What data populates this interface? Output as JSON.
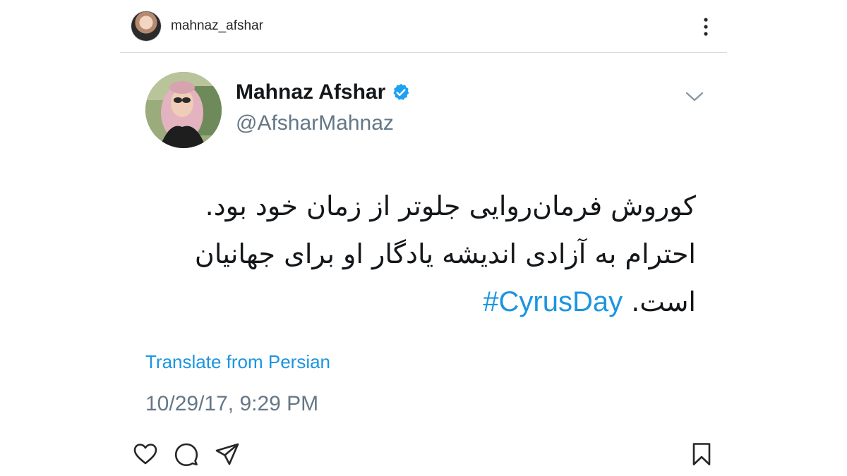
{
  "post": {
    "username": "mahnaz_afshar",
    "avatar_icon": "profile-photo",
    "more_icon": "more-options-icon"
  },
  "tweet": {
    "display_name": "Mahnaz Afshar",
    "handle": "@AfsharMahnaz",
    "verified": true,
    "verified_color": "#1da1f2",
    "text_lines": [
      "کوروش فرمان‌روایی جلوتر از زمان خود بود.",
      "احترام به آزادی اندیشه یادگار او برای جهانیان",
      "است."
    ],
    "hashtag": "#CyrusDay",
    "translate_label": "Translate from Persian",
    "timestamp": "10/29/17, 9:29 PM",
    "link_color": "#1b95e0"
  },
  "actions": {
    "like_icon": "heart-icon",
    "comment_icon": "comment-icon",
    "share_icon": "share-icon",
    "save_icon": "bookmark-icon"
  }
}
